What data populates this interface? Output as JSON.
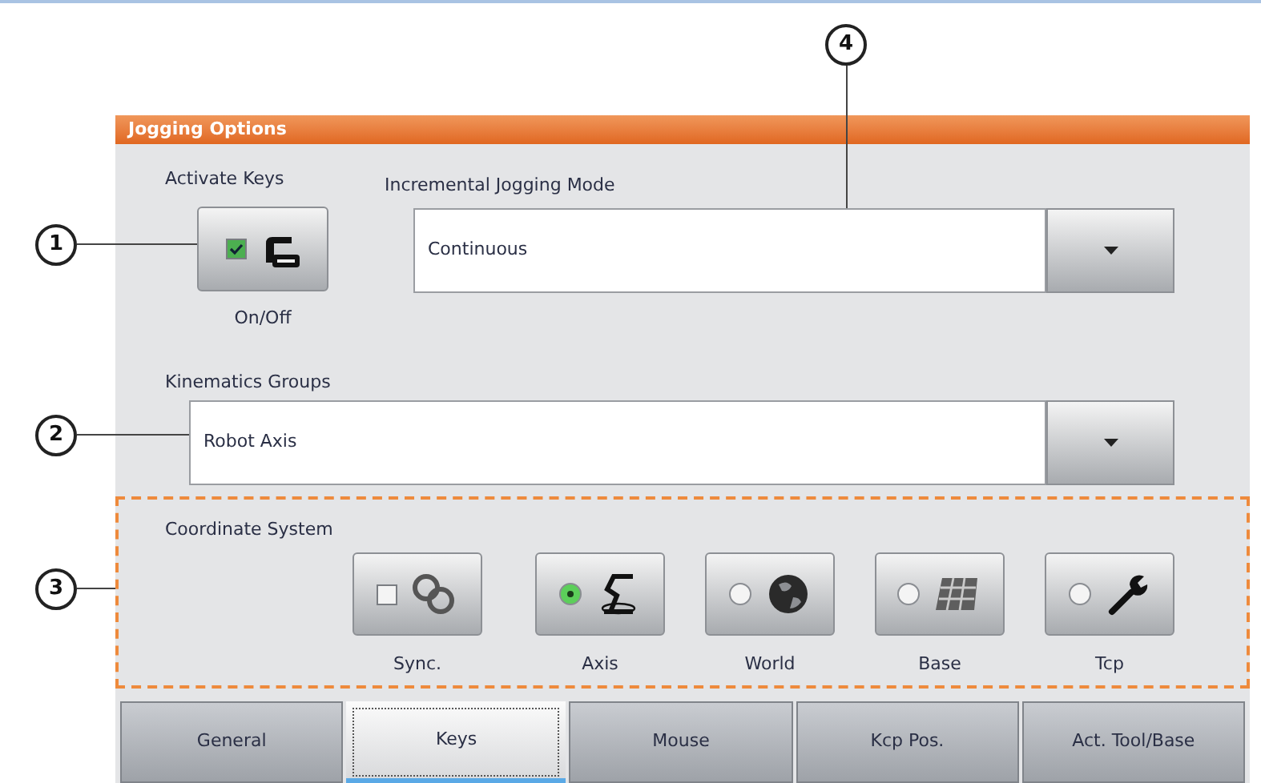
{
  "panel": {
    "title": "Jogging Options"
  },
  "activate_keys": {
    "label": "Activate Keys",
    "checked": true,
    "caption": "On/Off"
  },
  "incremental_mode": {
    "label": "Incremental Jogging Mode",
    "value": "Continuous"
  },
  "kinematics": {
    "label": "Kinematics Groups",
    "value": "Robot Axis"
  },
  "coordinate_system": {
    "label": "Coordinate System",
    "options": [
      {
        "kind": "check",
        "label": "Sync.",
        "checked": false
      },
      {
        "kind": "radio",
        "label": "Axis",
        "selected": true
      },
      {
        "kind": "radio",
        "label": "World",
        "selected": false
      },
      {
        "kind": "radio",
        "label": "Base",
        "selected": false
      },
      {
        "kind": "radio",
        "label": "Tcp",
        "selected": false
      }
    ]
  },
  "tabs": [
    {
      "label": "General",
      "selected": false
    },
    {
      "label": "Keys",
      "selected": true
    },
    {
      "label": "Mouse",
      "selected": false
    },
    {
      "label": "Kcp Pos.",
      "selected": false
    },
    {
      "label": "Act. Tool/Base",
      "selected": false
    }
  ],
  "callouts": [
    "1",
    "2",
    "3",
    "4"
  ]
}
